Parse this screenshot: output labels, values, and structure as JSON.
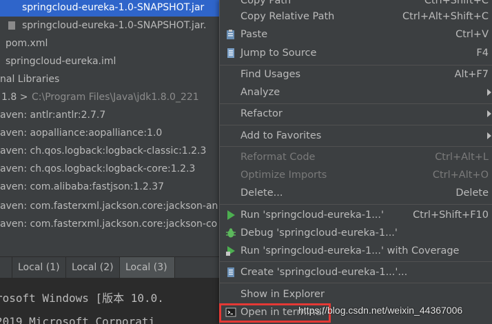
{
  "project_tree": {
    "rows": [
      {
        "text": "springcloud-eureka-1.0-SNAPSHOT.jar",
        "selected": true,
        "icon": "jar-icon"
      },
      {
        "text": "springcloud-eureka-1.0-SNAPSHOT.jar.",
        "selected": false,
        "icon": "jar-icon"
      },
      {
        "text": "pom.xml",
        "selected": false,
        "icon": "maven-file-icon"
      },
      {
        "text": "springcloud-eureka.iml",
        "selected": false,
        "icon": "iml-file-icon"
      },
      {
        "text": "nal Libraries",
        "selected": false
      },
      {
        "text": "1.8 >",
        "path": "C:\\Program Files\\Java\\jdk1.8.0_221",
        "selected": false
      },
      {
        "text": "aven: antlr:antlr:2.7.7",
        "selected": false
      },
      {
        "text": "aven: aopalliance:aopalliance:1.0",
        "selected": false
      },
      {
        "text": "aven: ch.qos.logback:logback-classic:1.2.3",
        "selected": false
      },
      {
        "text": "aven: ch.qos.logback:logback-core:1.2.3",
        "selected": false
      },
      {
        "text": "aven: com.alibaba:fastjson:1.2.37",
        "selected": false
      },
      {
        "text": "aven: com.fasterxml.jackson.core:jackson-an",
        "selected": false
      },
      {
        "text": "aven: com.fasterxml.jackson.core:jackson-co",
        "selected": false
      }
    ]
  },
  "terminal_tabs": [
    {
      "label": "",
      "active": false
    },
    {
      "label": "Local (1)",
      "active": false
    },
    {
      "label": "Local (2)",
      "active": false
    },
    {
      "label": "Local (3)",
      "active": true
    }
  ],
  "terminal": {
    "lines": [
      "rosoft Windows [版本 10.0.",
      "2019 Microsoft Corporati"
    ]
  },
  "context_menu": {
    "items": [
      {
        "label": "Copy Path",
        "shortcut": "Ctrl+Shift+C",
        "type": "item",
        "partial": true
      },
      {
        "label": "Copy Relative Path",
        "shortcut": "Ctrl+Alt+Shift+C",
        "type": "item"
      },
      {
        "label": "Paste",
        "shortcut": "Ctrl+V",
        "type": "item",
        "icon": "paste-icon"
      },
      {
        "label": "Jump to Source",
        "shortcut": "F4",
        "type": "item",
        "icon": "jump-to-source-icon"
      },
      {
        "label": "Find Usages",
        "shortcut": "Alt+F7",
        "type": "item"
      },
      {
        "label": "Analyze",
        "shortcut": "",
        "type": "submenu"
      },
      {
        "label": "Refactor",
        "shortcut": "",
        "type": "submenu"
      },
      {
        "label": "Add to Favorites",
        "shortcut": "",
        "type": "submenu"
      },
      {
        "label": "Reformat Code",
        "shortcut": "Ctrl+Alt+L",
        "type": "item",
        "disabled": true
      },
      {
        "label": "Optimize Imports",
        "shortcut": "Ctrl+Alt+O",
        "type": "item",
        "disabled": true
      },
      {
        "label": "Delete...",
        "shortcut": "Delete",
        "type": "item"
      },
      {
        "label": "Run 'springcloud-eureka-1...'",
        "shortcut": "Ctrl+Shift+F10",
        "type": "item",
        "icon": "run-icon"
      },
      {
        "label": "Debug 'springcloud-eureka-1...'",
        "shortcut": "",
        "type": "item",
        "icon": "debug-icon"
      },
      {
        "label": "Run 'springcloud-eureka-1...' with Coverage",
        "shortcut": "",
        "type": "item",
        "icon": "coverage-icon"
      },
      {
        "label": "Create 'springcloud-eureka-1...'...",
        "shortcut": "",
        "type": "item",
        "icon": "create-config-icon"
      },
      {
        "label": "Show in Explorer",
        "shortcut": "",
        "type": "item"
      },
      {
        "label": "Open in terminal",
        "shortcut": "",
        "type": "item",
        "icon": "terminal-icon",
        "highlighted": true
      }
    ]
  },
  "watermark": {
    "text": "https://blog.csdn.net/weixin_44367006"
  },
  "colors": {
    "selection": "#2f65ca",
    "panel_bg": "#3c3f41",
    "terminal_bg": "#2b2b2b",
    "highlight_box": "#e53935",
    "run_green": "#4caf50"
  }
}
